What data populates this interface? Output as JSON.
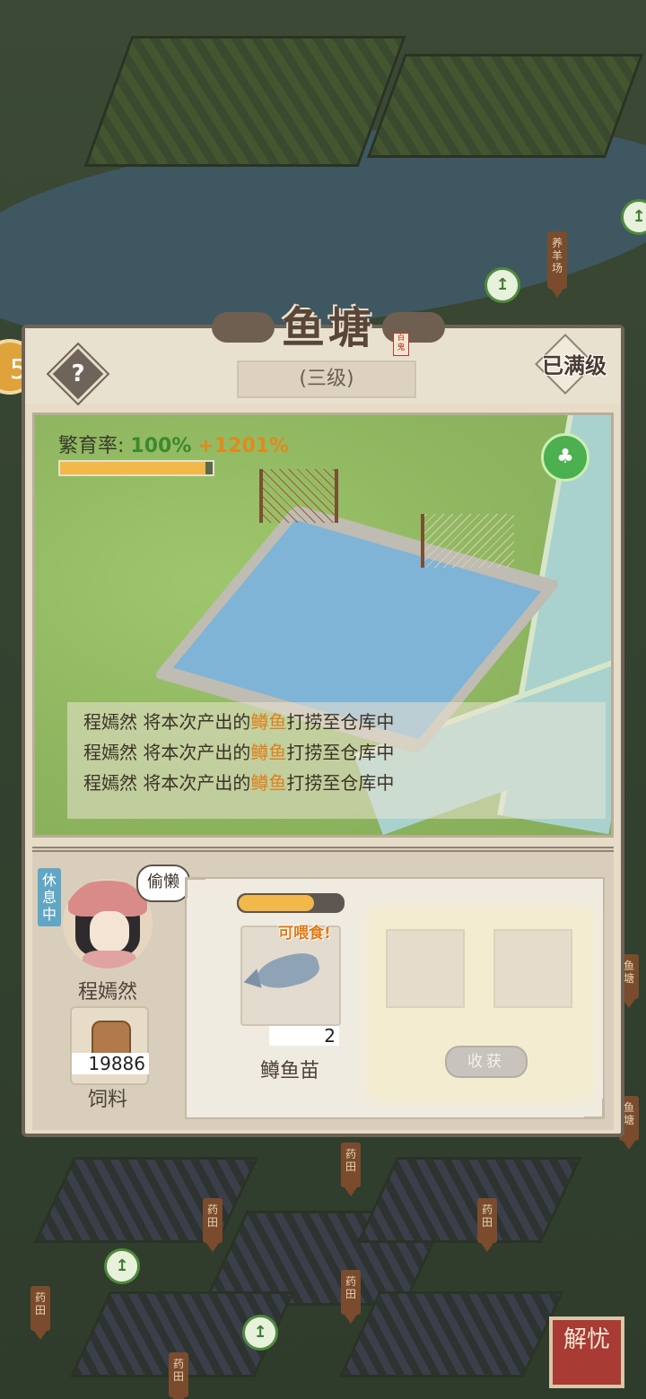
{
  "map": {
    "signs": [
      "养羊场",
      "药田",
      "药田",
      "药田",
      "药田",
      "药田",
      "药田",
      "鱼塘",
      "鱼塘"
    ],
    "side_badge": "5",
    "corner_button": "解忧"
  },
  "dialog": {
    "title": "鱼塘",
    "seal": "百鬼",
    "help": "?",
    "level": "(三级)",
    "max_level": "已满级",
    "breed": {
      "label": "繁育率:",
      "value": "100%",
      "bonus": "+1201%",
      "progress": 0.95
    },
    "logs": [
      {
        "worker": "程嫣然",
        "mid": " 将本次产出的",
        "item": "鳟鱼",
        "tail": "打捞至仓库中"
      },
      {
        "worker": "程嫣然",
        "mid": " 将本次产出的",
        "item": "鳟鱼",
        "tail": "打捞至仓库中"
      },
      {
        "worker": "程嫣然",
        "mid": " 将本次产出的",
        "item": "鳟鱼",
        "tail": "打捞至仓库中"
      }
    ],
    "worker": {
      "status": "休息中",
      "bubble": "偷懒",
      "name": "程嫣然"
    },
    "feed": {
      "count": "19886",
      "label": "饲料"
    },
    "seed": {
      "progress": 0.72,
      "tag": "可喂食!",
      "count": "2",
      "label": "鳟鱼苗"
    },
    "harvest_button": "收获"
  }
}
